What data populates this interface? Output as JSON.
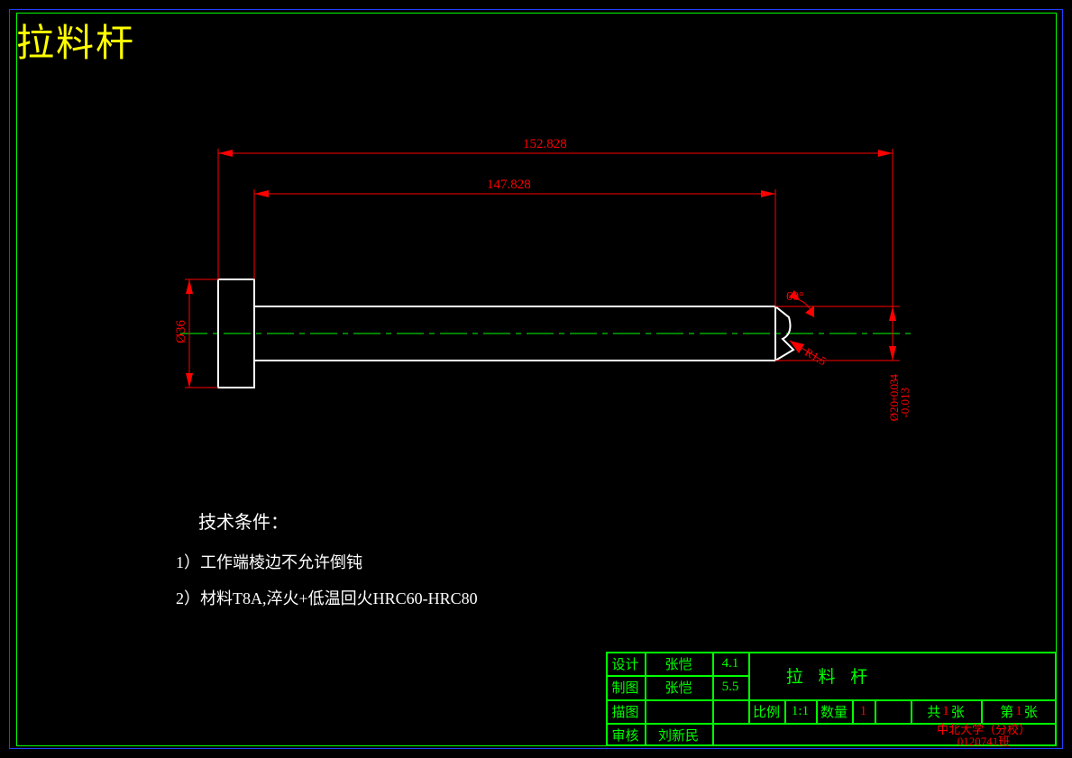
{
  "title": "拉料杆",
  "dimensions": {
    "length_total": "152.828",
    "length_shaft": "147.828",
    "dia_head": "Ø36",
    "angle_tip": "60°",
    "radius_tip": "R1.5",
    "dia_shaft": "Ø20",
    "tol_upper": "-0.013",
    "tol_lower": "+0.034"
  },
  "tech": {
    "heading": "技术条件：",
    "item1": "1）工作端棱边不允许倒钝",
    "item2": "2）材料T8A,淬火+低温回火HRC60-HRC80"
  },
  "titleblock": {
    "part_name": "拉 料 杆",
    "rows": {
      "design_label": "设计",
      "design_name": "张恺",
      "design_date": "4.1",
      "drawn_label": "制图",
      "drawn_name": "张恺",
      "drawn_date": "5.5",
      "traced_label": "描图",
      "checked_label": "审核",
      "checked_name": "刘新民"
    },
    "scale_label": "比例",
    "scale_value": "1:1",
    "qty_label": "数量",
    "qty_value": "1",
    "sheet_total_prefix": "共",
    "sheet_total_value": "1",
    "sheet_total_suffix": "张",
    "sheet_num_prefix": "第",
    "sheet_num_value": "1",
    "sheet_num_suffix": "张",
    "school": "中北大学（分校）",
    "class": "0120741班"
  }
}
